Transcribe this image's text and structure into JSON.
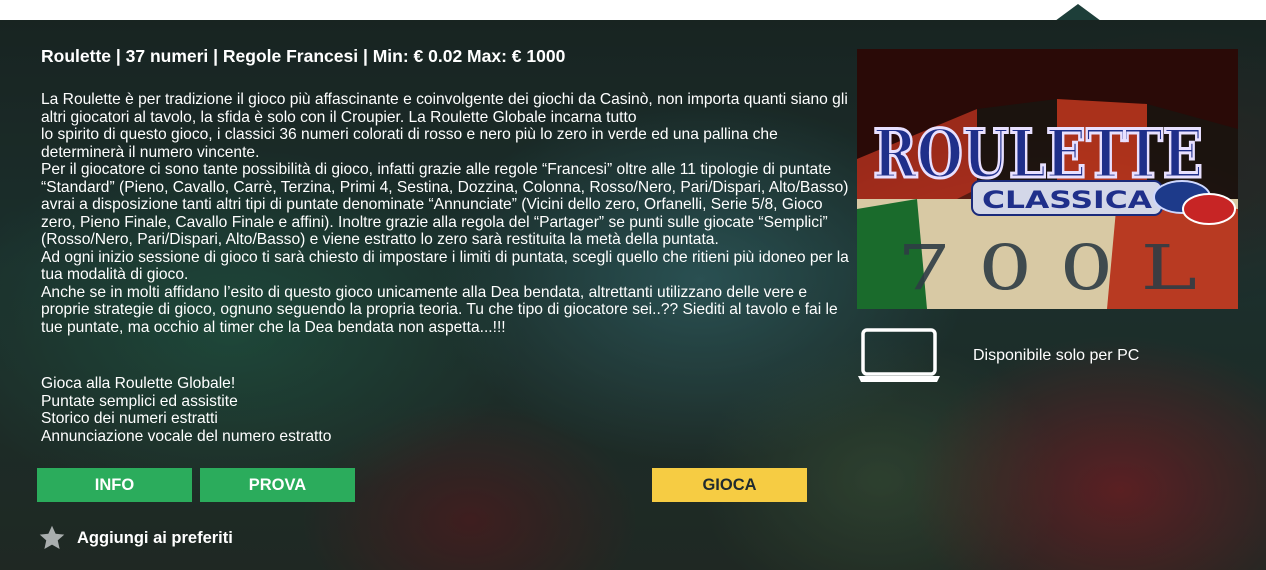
{
  "header": {
    "title": "Roulette | 37 numeri | Regole Francesi | Min: € 0.02 Max: € 1000"
  },
  "description": {
    "text": "La Roulette è per tradizione il gioco più affascinante e coinvolgente dei giochi da Casinò, non importa quanti siano gli altri giocatori al tavolo, la sfida è solo con il Croupier. La Roulette Globale incarna tutto\n lo spirito di questo gioco, i classici 36 numeri colorati di rosso e nero più lo zero in verde ed una pallina che determinerà il numero vincente.\nPer il giocatore ci sono tante possibilità di gioco, infatti grazie alle regole “Francesi” oltre alle 11 tipologie di puntate “Standard” (Pieno, Cavallo, Carrè, Terzina, Primi 4, Sestina, Dozzina, Colonna, Rosso/Nero, Pari/Dispari, Alto/Basso) avrai a disposizione tanti altri tipi di puntate denominate “Annunciate” (Vicini dello zero, Orfanelli, Serie 5/8, Gioco zero, Pieno Finale, Cavallo Finale e affini). Inoltre grazie alla regola del “Partager” se punti sulle giocate “Semplici” (Rosso/Nero, Pari/Dispari, Alto/Basso) e viene estratto lo zero sarà restituita la metà della puntata.\nAd ogni inizio sessione di gioco ti sarà chiesto di impostare i limiti di puntata, scegli quello che ritieni più idoneo per la tua modalità di gioco.\nAnche se in molti affidano l’esito di questo gioco unicamente alla Dea bendata, altrettanti utilizzano delle vere e proprie strategie di gioco, ognuno seguendo la propria teoria. Tu che tipo di giocatore sei..?? Siediti al tavolo e fai le tue puntate, ma occhio al timer che la Dea bendata non aspetta...!!!"
  },
  "features": [
    "Gioca alla Roulette Globale!",
    "Puntate semplici ed assistite",
    "Storico dei numeri estratti",
    "Annunciazione vocale del numero estratto"
  ],
  "buttons": {
    "info": "INFO",
    "prova": "PROVA",
    "gioca": "GIOCA"
  },
  "favorite": {
    "label": "Aggiungi ai preferiti"
  },
  "thumbnail": {
    "logo_word": "ROULETTE",
    "logo_sub": "CLASSICA",
    "wheel_numbers": "7 0 0 L"
  },
  "platform": {
    "label": "Disponibile solo per PC",
    "icon": "laptop-icon"
  },
  "colors": {
    "green_button": "#2bac5c",
    "yellow_button": "#f6cc43",
    "text": "#ffffff"
  }
}
